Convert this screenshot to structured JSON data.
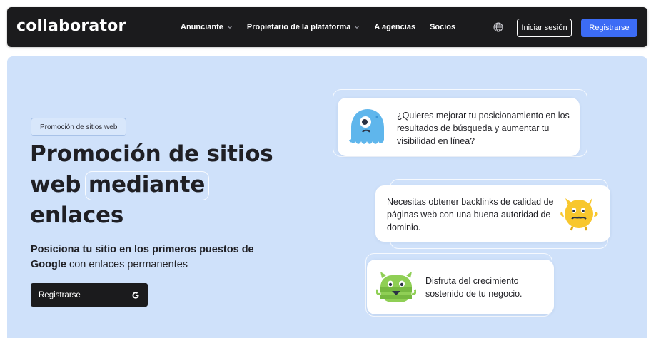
{
  "nav": {
    "logo": "collaborator",
    "links": [
      {
        "label": "Anunciante",
        "has_dropdown": true
      },
      {
        "label": "Propietario de la plataforma",
        "has_dropdown": true
      },
      {
        "label": "A agencias",
        "has_dropdown": false
      },
      {
        "label": "Socios",
        "has_dropdown": false
      }
    ],
    "globe_icon": "globe-icon",
    "login_label": "Iniciar sesión",
    "register_label": "Registrarse"
  },
  "hero": {
    "badge": "Promoción de sitios web",
    "headline_line1": "Promoción de sitios",
    "headline_line2_a": "web",
    "headline_line2_b": "mediante",
    "headline_line3": "enlaces",
    "sub_bold": "Posiciona tu sitio en los primeros puestos de Google",
    "sub_rest": "con enlaces permanentes",
    "cta_label": "Registrarse",
    "cta_icon": "google-icon"
  },
  "bubbles": [
    {
      "text": "¿Quieres mejorar tu posicionamiento en los resultados de búsqueda y aumentar tu visibilidad en línea?",
      "avatar": "blue-monster-icon"
    },
    {
      "text": "Necesitas obtener backlinks de calidad de páginas web con una buena autoridad de dominio.",
      "avatar": "yellow-monster-icon"
    },
    {
      "text": "Disfruta del crecimiento sostenido de tu negocio.",
      "avatar": "green-monster-icon"
    }
  ],
  "colors": {
    "nav_bg": "#1b1b1d",
    "accent": "#3c6cf5",
    "hero_bg": "#cfe1fa"
  }
}
